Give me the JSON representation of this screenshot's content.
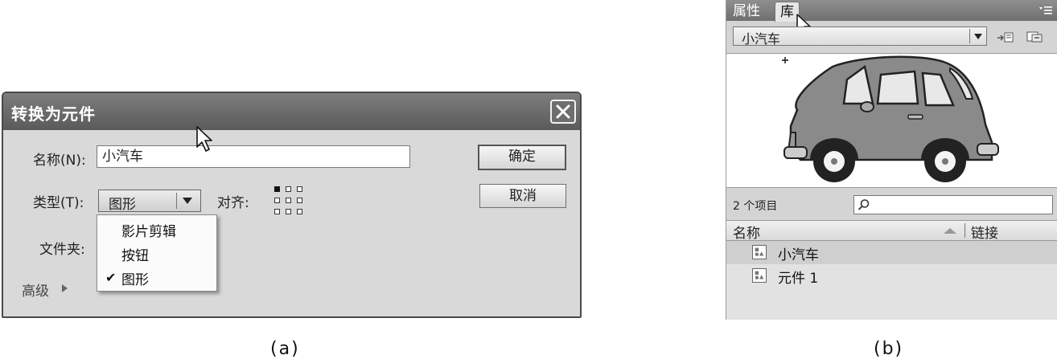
{
  "dialog": {
    "title": "转换为元件",
    "name_label": "名称(N):",
    "name_value": "小汽车",
    "ok_label": "确定",
    "cancel_label": "取消",
    "type_label": "类型(T):",
    "type_value": "图形",
    "align_label": "对齐:",
    "folder_label": "文件夹:",
    "advanced_label": "高级",
    "type_menu": [
      "影片剪辑",
      "按钮",
      "图形"
    ],
    "type_menu_checked": 2
  },
  "panel": {
    "tabs": [
      "属性",
      "库"
    ],
    "active_tab": 1,
    "library_select": "小汽车",
    "item_count": "2 个项目",
    "columns": [
      "名称",
      "链接"
    ],
    "items": [
      "小汽车",
      "元件 1"
    ],
    "selected_item": 0
  },
  "captions": {
    "left": "(a)",
    "right": "(b)"
  },
  "colors": {
    "titlebar": "#6a6a6a",
    "dialog_bg": "#d9d9d9",
    "car_body": "#8a8a8a",
    "car_outline": "#222222"
  },
  "icons": [
    "close-icon",
    "dropdown-arrow-icon",
    "registration-grid-icon",
    "expand-arrow-icon",
    "checkmark-icon",
    "mouse-cursor-icon",
    "new-symbol-icon",
    "properties-icon",
    "panel-menu-icon",
    "search-icon",
    "sort-arrow-icon",
    "graphic-symbol-icon"
  ]
}
